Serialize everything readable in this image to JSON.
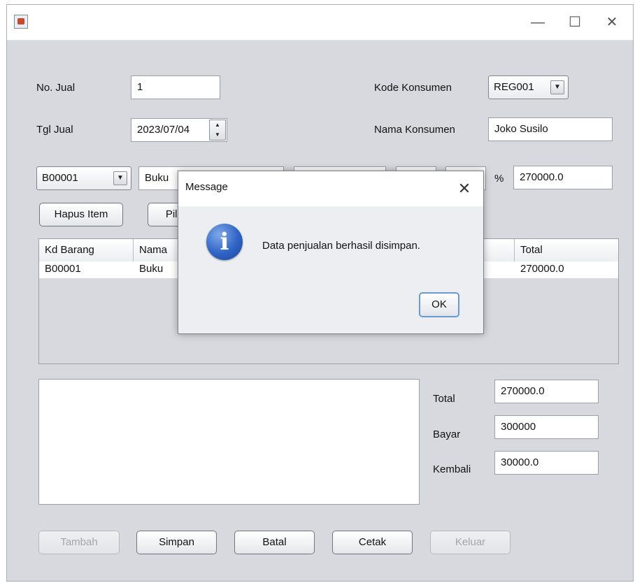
{
  "window": {
    "title": "",
    "minimize": "—",
    "maximize": "☐",
    "close": "✕"
  },
  "form": {
    "no_jual_label": "No. Jual",
    "no_jual_value": "1",
    "tgl_jual_label": "Tgl Jual",
    "tgl_jual_value": "2023/07/04",
    "kode_konsumen_label": "Kode Konsumen",
    "kode_konsumen_value": "REG001",
    "nama_konsumen_label": "Nama Konsumen",
    "nama_konsumen_value": "Joko Susilo"
  },
  "item_row": {
    "kode_barang": "B00001",
    "nama_barang": "Buku",
    "field3": "",
    "field4": "",
    "discount": "",
    "percent_label": "%",
    "subtotal": "270000.0"
  },
  "buttons": {
    "hapus_item": "Hapus Item",
    "pilih": "Pilih",
    "tambah": "Tambah",
    "simpan": "Simpan",
    "batal": "Batal",
    "cetak": "Cetak",
    "keluar": "Keluar"
  },
  "table": {
    "columns": [
      "Kd Barang",
      "Nama",
      "Total"
    ],
    "rows": [
      {
        "kd_barang": "B00001",
        "nama": "Buku",
        "total": "270000.0"
      }
    ]
  },
  "summary": {
    "total_label": "Total",
    "total_value": "270000.0",
    "bayar_label": "Bayar",
    "bayar_value": "300000",
    "kembali_label": "Kembali",
    "kembali_value": "30000.0"
  },
  "dialog": {
    "title": "Message",
    "message": "Data penjualan berhasil disimpan.",
    "ok_label": "OK",
    "icon": "info-icon",
    "icon_glyph": "i",
    "close": "✕"
  },
  "colors": {
    "window_bg": "#d7d9df",
    "dialog_bg": "#eceef2",
    "info_icon": "#2f64c6",
    "ok_border": "#6a9ad1"
  }
}
